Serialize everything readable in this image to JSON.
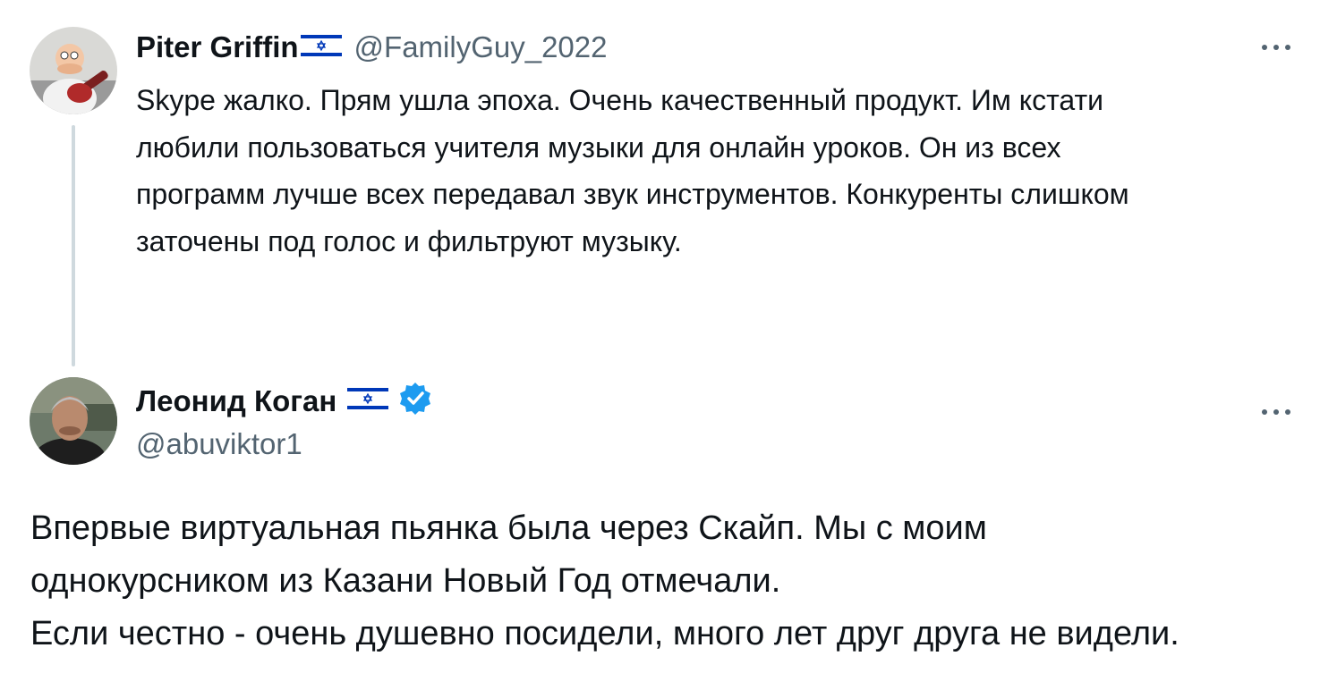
{
  "tweet1": {
    "display_name": "Piter Griffin",
    "flag": "israel-flag",
    "handle": "@FamilyGuy_2022",
    "more_icon": "more-dots-icon",
    "text_lines": [
      "Skype жалко. Прям ушла эпоха. Очень качественный продукт. Им кстати",
      "любили пользоваться учителя музыки для онлайн уроков. Он из всех",
      "программ лучше всех передавал звук инструментов. Конкуренты слишком",
      "заточены под голос и фильтруют музыку."
    ]
  },
  "tweet2": {
    "display_name": "Леонид Коган",
    "flag": "israel-flag",
    "verified_icon": "verified-badge-icon",
    "handle": "@abuviktor1",
    "more_icon": "more-dots-icon",
    "text_lines": [
      "Впервые виртуальная пьянка была через Скайп. Мы с моим",
      "однокурсником из Казани Новый Год отмечали.",
      "Если честно - очень душевно посидели, много лет друг друга не видели."
    ]
  },
  "colors": {
    "text": "#0f1419",
    "secondary": "#536471",
    "thread_line": "#cfd9de",
    "verified": "#1d9bf0",
    "flag_blue": "#0038b8"
  }
}
